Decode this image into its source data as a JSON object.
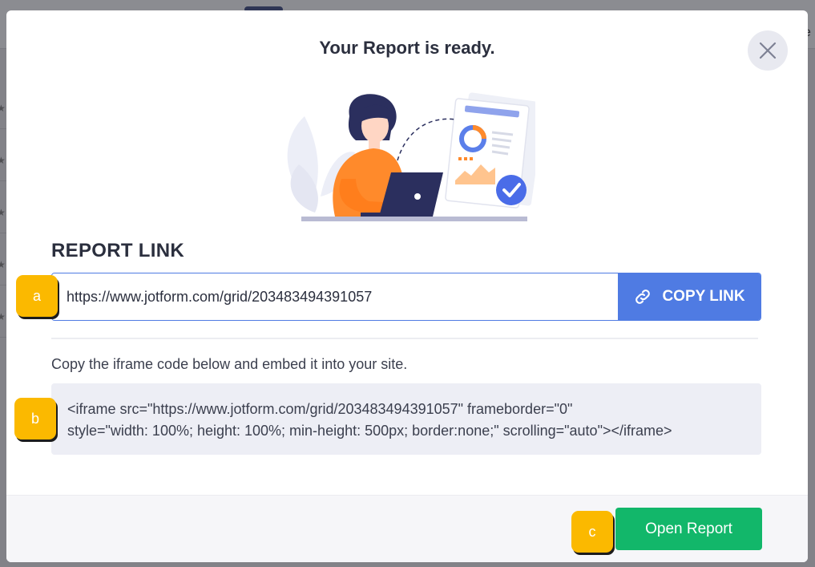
{
  "modal": {
    "title": "Your Report is ready.",
    "close_icon": "close-icon"
  },
  "report_link": {
    "section_label": "REPORT LINK",
    "url": "https://www.jotform.com/grid/203483494391057",
    "copy_button_label": "COPY LINK",
    "copy_icon": "link-icon"
  },
  "embed": {
    "instructions": "Copy the iframe code below and embed it into your site.",
    "code": "<iframe src=\"https://www.jotform.com/grid/203483494391057\" frameborder=\"0\"\nstyle=\"width: 100%; height: 100%; min-height: 500px; border:none;\" scrolling=\"auto\"></iframe>"
  },
  "footer": {
    "open_button_label": "Open Report"
  },
  "annotations": {
    "marker_a": "a",
    "marker_b": "b",
    "marker_c": "c"
  },
  "colors": {
    "primary": "#4f7be3",
    "success": "#12b76a",
    "marker": "#fbb900",
    "illustration_orange": "#ff8a2b",
    "illustration_navy": "#2b2f5e"
  }
}
